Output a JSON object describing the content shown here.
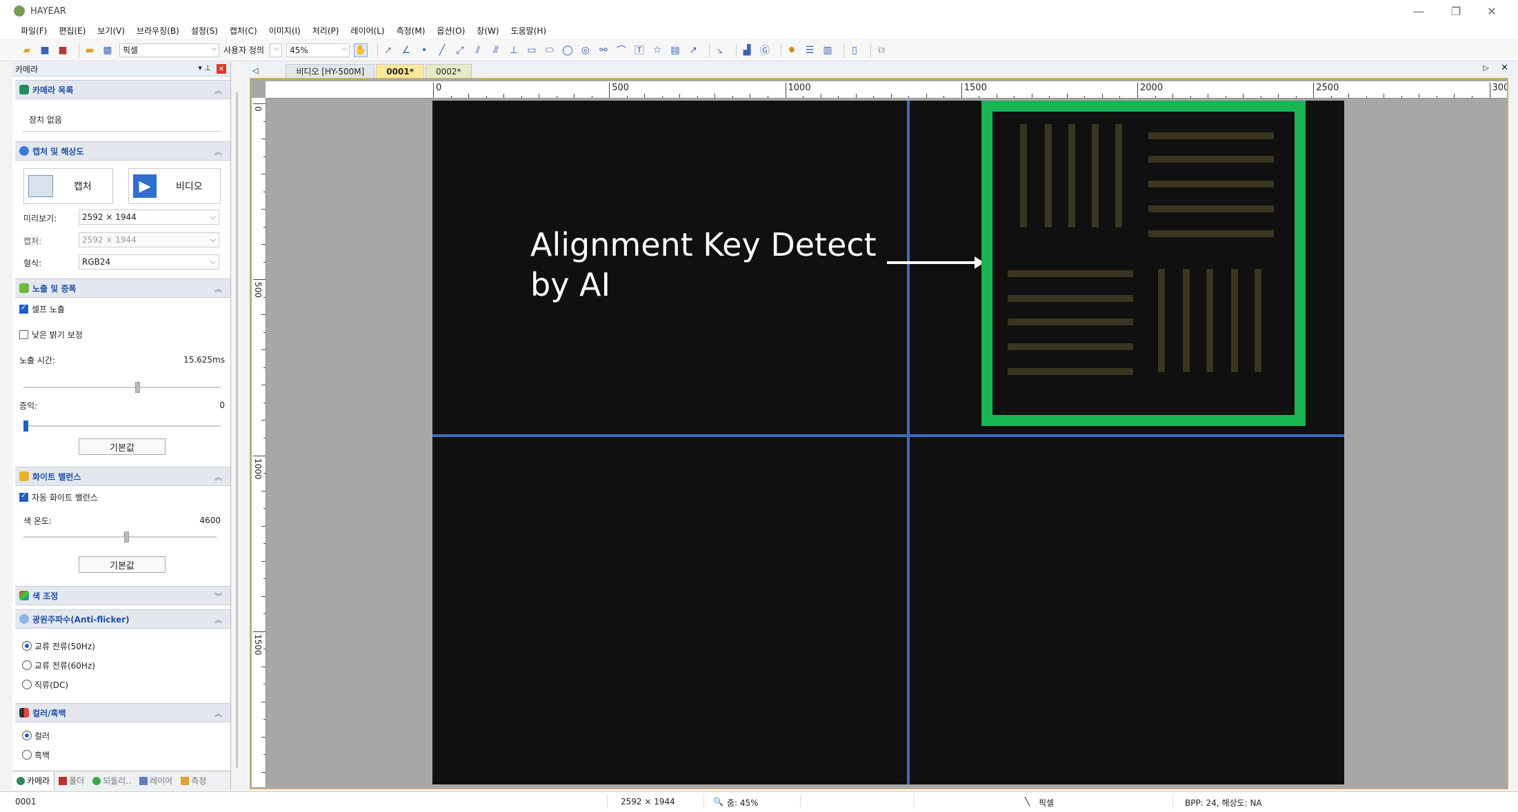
{
  "window": {
    "title": "HAYEAR"
  },
  "menu": [
    "파일(F)",
    "편집(E)",
    "보기(V)",
    "브라우징(B)",
    "설정(S)",
    "캡처(C)",
    "이미지(I)",
    "처리(P)",
    "레이어(L)",
    "측정(M)",
    "옵션(O)",
    "창(W)",
    "도움말(H)"
  ],
  "toolbar": {
    "unit_select": "픽셀",
    "zoom_mode": "사용자 정의",
    "zoom_value": "45%"
  },
  "left_panel": {
    "title": "카메라",
    "camera_list": {
      "title": "카메라 목록",
      "empty_text": "장치 없음"
    },
    "capture_resolution": {
      "title": "캡처 및 해상도",
      "capture_label": "캡처",
      "video_label": "비디오",
      "preview_label": "미리보기:",
      "preview_value": "2592 × 1944",
      "capture_label2": "캡처:",
      "capture_value": "2592 × 1944",
      "format_label": "형식:",
      "format_value": "RGB24"
    },
    "exposure_gain": {
      "title": "노출 및 증폭",
      "auto_exposure": "셀프 노출",
      "low_light": "낮은 밝기 보정",
      "exposure_time_label": "노출 시간:",
      "exposure_time_value": "15.625ms",
      "gain_label": "증익:",
      "gain_value": "0",
      "default_button": "기본값"
    },
    "white_balance": {
      "title": "화이트 밸런스",
      "auto_wb": "자동 화이트 밸런스",
      "temp_label": "색 온도:",
      "temp_value": "4600",
      "default_button": "기본값"
    },
    "color_adjust": {
      "title": "색 조정"
    },
    "anti_flicker": {
      "title": "광원주파수(Anti-flicker)",
      "options": [
        "교류 전류(50Hz)",
        "교류 전류(60Hz)",
        "직류(DC)"
      ]
    },
    "color_mono": {
      "title": "컬러/흑백",
      "options": [
        "컬러",
        "흑백"
      ]
    }
  },
  "bottom_tabs": [
    "카메라",
    "폴더",
    "되돌리..",
    "레이어",
    "측정"
  ],
  "doc_tabs": [
    "비디오 [HY-500M]",
    "0001*",
    "0002*"
  ],
  "ruler": {
    "h_labels": [
      "0",
      "500",
      "1000",
      "1500",
      "2000",
      "2500",
      "300"
    ],
    "v_labels": [
      "0",
      "500",
      "1000",
      "1500"
    ]
  },
  "image": {
    "caption_line1": "Alignment Key Detect",
    "caption_line2": "by AI",
    "box_color": "#17b653",
    "crosshair_color": "#3d6bc4"
  },
  "status": {
    "name": "0001",
    "resolution": "2592 × 1944",
    "zoom": "줌: 45%",
    "unit": "픽셀",
    "bpp": "BPP: 24, 해상도: NA"
  }
}
